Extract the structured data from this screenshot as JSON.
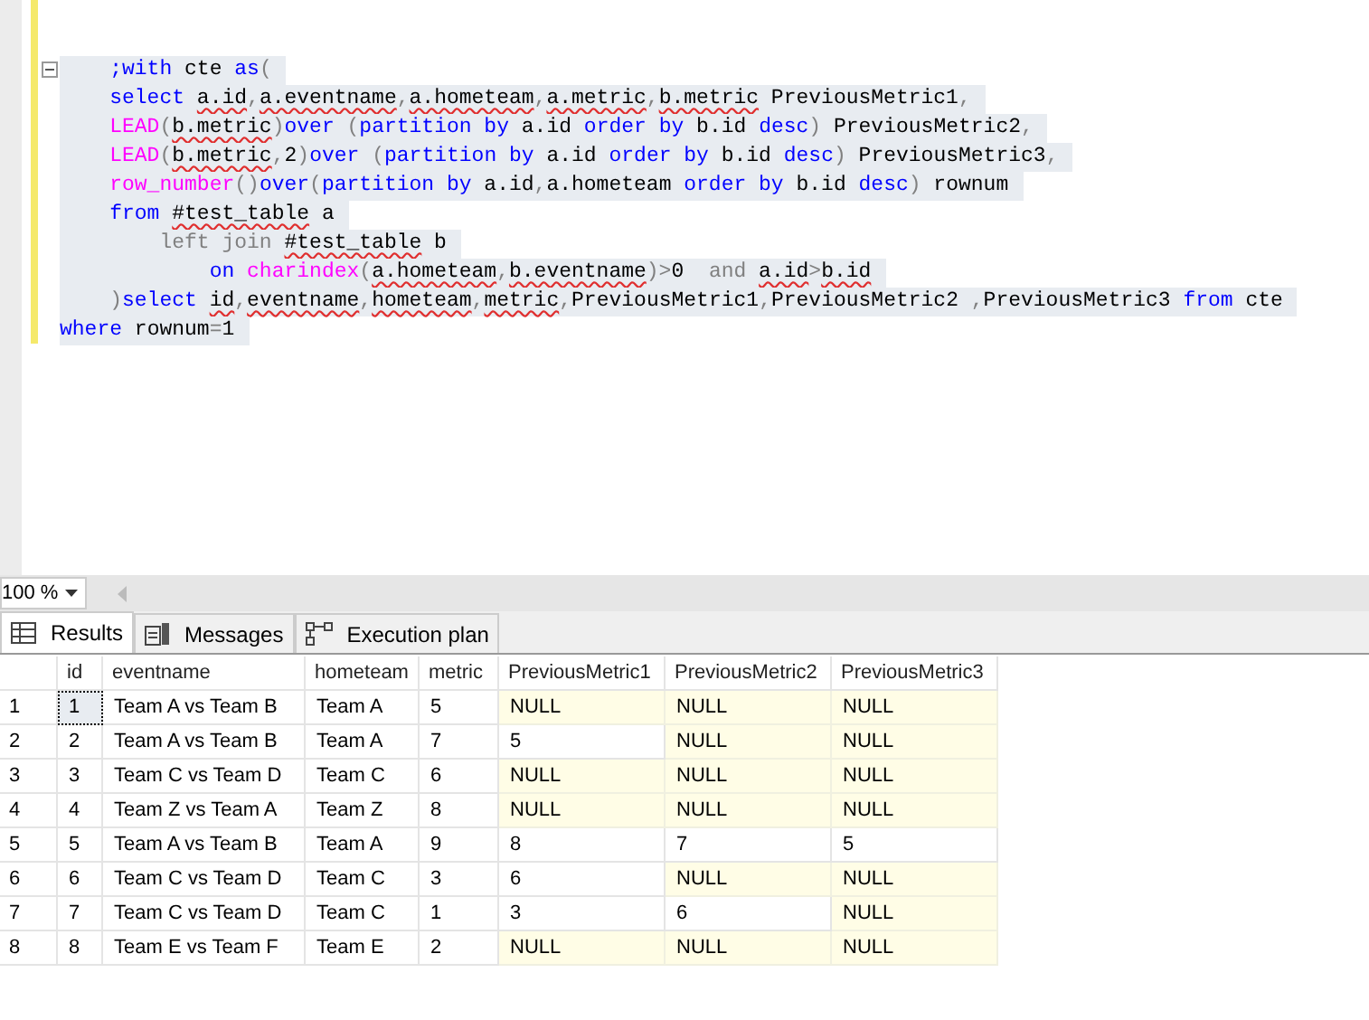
{
  "editor": {
    "fold_expanded": true,
    "lines": [
      [
        {
          "t": "    ;with ",
          "kind": "kw"
        },
        {
          "t": "cte ",
          "kind": "tx"
        },
        {
          "t": "as",
          "kind": "kw"
        },
        {
          "t": "(",
          "kind": "op"
        }
      ],
      [
        {
          "t": "    select ",
          "kind": "kw"
        },
        {
          "t": "a.id",
          "kind": "sq"
        },
        {
          "t": ",",
          "kind": "op"
        },
        {
          "t": "a.eventname",
          "kind": "sq"
        },
        {
          "t": ",",
          "kind": "op"
        },
        {
          "t": "a.hometeam",
          "kind": "sq"
        },
        {
          "t": ",",
          "kind": "op"
        },
        {
          "t": "a.metric",
          "kind": "sq"
        },
        {
          "t": ",",
          "kind": "op"
        },
        {
          "t": "b.metric",
          "kind": "sq"
        },
        {
          "t": " PreviousMetric1",
          "kind": "tx"
        },
        {
          "t": ",",
          "kind": "op"
        }
      ],
      [
        {
          "t": "    LEAD",
          "kind": "fn"
        },
        {
          "t": "(",
          "kind": "op"
        },
        {
          "t": "b.metric",
          "kind": "sq"
        },
        {
          "t": ")",
          "kind": "op"
        },
        {
          "t": "over ",
          "kind": "kw"
        },
        {
          "t": "(",
          "kind": "op"
        },
        {
          "t": "partition by",
          "kind": "kw"
        },
        {
          "t": " a.id ",
          "kind": "tx"
        },
        {
          "t": "order by",
          "kind": "kw"
        },
        {
          "t": " b.id ",
          "kind": "tx"
        },
        {
          "t": "desc",
          "kind": "kw"
        },
        {
          "t": ")",
          "kind": "op"
        },
        {
          "t": " PreviousMetric2",
          "kind": "tx"
        },
        {
          "t": ",",
          "kind": "op"
        }
      ],
      [
        {
          "t": "    LEAD",
          "kind": "fn"
        },
        {
          "t": "(",
          "kind": "op"
        },
        {
          "t": "b.metric",
          "kind": "sq"
        },
        {
          "t": ",",
          "kind": "op"
        },
        {
          "t": "2",
          "kind": "tx"
        },
        {
          "t": ")",
          "kind": "op"
        },
        {
          "t": "over ",
          "kind": "kw"
        },
        {
          "t": "(",
          "kind": "op"
        },
        {
          "t": "partition by",
          "kind": "kw"
        },
        {
          "t": " a.id ",
          "kind": "tx"
        },
        {
          "t": "order by",
          "kind": "kw"
        },
        {
          "t": " b.id ",
          "kind": "tx"
        },
        {
          "t": "desc",
          "kind": "kw"
        },
        {
          "t": ")",
          "kind": "op"
        },
        {
          "t": " PreviousMetric3",
          "kind": "tx"
        },
        {
          "t": ",",
          "kind": "op"
        }
      ],
      [
        {
          "t": "    row_number",
          "kind": "fn"
        },
        {
          "t": "()",
          "kind": "op"
        },
        {
          "t": "over",
          "kind": "kw"
        },
        {
          "t": "(",
          "kind": "op"
        },
        {
          "t": "partition by",
          "kind": "kw"
        },
        {
          "t": " a.id",
          "kind": "tx"
        },
        {
          "t": ",",
          "kind": "op"
        },
        {
          "t": "a.hometeam ",
          "kind": "tx"
        },
        {
          "t": "order by",
          "kind": "kw"
        },
        {
          "t": " b.id ",
          "kind": "tx"
        },
        {
          "t": "desc",
          "kind": "kw"
        },
        {
          "t": ")",
          "kind": "op"
        },
        {
          "t": " rownum",
          "kind": "tx"
        }
      ],
      [
        {
          "t": "    from ",
          "kind": "kw"
        },
        {
          "t": "#test_table",
          "kind": "sq"
        },
        {
          "t": " a",
          "kind": "tx"
        }
      ],
      [
        {
          "t": "        left join ",
          "kind": "op"
        },
        {
          "t": "#test_table",
          "kind": "sq"
        },
        {
          "t": " b",
          "kind": "tx"
        }
      ],
      [
        {
          "t": "            on ",
          "kind": "kw"
        },
        {
          "t": "charindex",
          "kind": "fn"
        },
        {
          "t": "(",
          "kind": "op"
        },
        {
          "t": "a.hometeam",
          "kind": "sq"
        },
        {
          "t": ",",
          "kind": "op"
        },
        {
          "t": "b.eventname",
          "kind": "sq"
        },
        {
          "t": ")>",
          "kind": "op"
        },
        {
          "t": "0  ",
          "kind": "tx"
        },
        {
          "t": "and ",
          "kind": "op"
        },
        {
          "t": "a.id",
          "kind": "sq"
        },
        {
          "t": ">",
          "kind": "op"
        },
        {
          "t": "b.id",
          "kind": "sq"
        }
      ],
      [
        {
          "t": "    )",
          "kind": "op"
        },
        {
          "t": "select ",
          "kind": "kw"
        },
        {
          "t": "id",
          "kind": "sq"
        },
        {
          "t": ",",
          "kind": "op"
        },
        {
          "t": "eventname",
          "kind": "sq"
        },
        {
          "t": ",",
          "kind": "op"
        },
        {
          "t": "hometeam",
          "kind": "sq"
        },
        {
          "t": ",",
          "kind": "op"
        },
        {
          "t": "metric",
          "kind": "sq"
        },
        {
          "t": ",",
          "kind": "op"
        },
        {
          "t": "PreviousMetric1",
          "kind": "tx"
        },
        {
          "t": ",",
          "kind": "op"
        },
        {
          "t": "PreviousMetric2 ",
          "kind": "tx"
        },
        {
          "t": ",",
          "kind": "op"
        },
        {
          "t": "PreviousMetric3 ",
          "kind": "tx"
        },
        {
          "t": "from",
          "kind": "kw"
        },
        {
          "t": " cte",
          "kind": "tx"
        }
      ],
      [
        {
          "t": "where",
          "kind": "kw"
        },
        {
          "t": " rownum",
          "kind": "tx"
        },
        {
          "t": "=",
          "kind": "op"
        },
        {
          "t": "1",
          "kind": "tx"
        }
      ]
    ]
  },
  "zoom": {
    "value": "100 %"
  },
  "tabs": [
    {
      "label": "Results",
      "selected": true
    },
    {
      "label": "Messages",
      "selected": false
    },
    {
      "label": "Execution plan",
      "selected": false
    }
  ],
  "grid": {
    "columns": [
      "id",
      "eventname",
      "hometeam",
      "metric",
      "PreviousMetric1",
      "PreviousMetric2",
      "PreviousMetric3"
    ],
    "rows": [
      {
        "header": "1",
        "cells": [
          {
            "text": "1",
            "null": false,
            "focused": true
          },
          {
            "text": "Team A vs Team B",
            "null": false,
            "focused": false
          },
          {
            "text": "Team A",
            "null": false,
            "focused": false
          },
          {
            "text": "5",
            "null": false,
            "focused": false
          },
          {
            "text": "NULL",
            "null": true,
            "focused": false
          },
          {
            "text": "NULL",
            "null": true,
            "focused": false
          },
          {
            "text": "NULL",
            "null": true,
            "focused": false
          }
        ]
      },
      {
        "header": "2",
        "cells": [
          {
            "text": "2",
            "null": false,
            "focused": false
          },
          {
            "text": "Team A vs Team B",
            "null": false,
            "focused": false
          },
          {
            "text": "Team A",
            "null": false,
            "focused": false
          },
          {
            "text": "7",
            "null": false,
            "focused": false
          },
          {
            "text": "5",
            "null": false,
            "focused": false
          },
          {
            "text": "NULL",
            "null": true,
            "focused": false
          },
          {
            "text": "NULL",
            "null": true,
            "focused": false
          }
        ]
      },
      {
        "header": "3",
        "cells": [
          {
            "text": "3",
            "null": false,
            "focused": false
          },
          {
            "text": "Team C vs Team D",
            "null": false,
            "focused": false
          },
          {
            "text": "Team C",
            "null": false,
            "focused": false
          },
          {
            "text": "6",
            "null": false,
            "focused": false
          },
          {
            "text": "NULL",
            "null": true,
            "focused": false
          },
          {
            "text": "NULL",
            "null": true,
            "focused": false
          },
          {
            "text": "NULL",
            "null": true,
            "focused": false
          }
        ]
      },
      {
        "header": "4",
        "cells": [
          {
            "text": "4",
            "null": false,
            "focused": false
          },
          {
            "text": "Team Z vs Team A",
            "null": false,
            "focused": false
          },
          {
            "text": "Team Z",
            "null": false,
            "focused": false
          },
          {
            "text": "8",
            "null": false,
            "focused": false
          },
          {
            "text": "NULL",
            "null": true,
            "focused": false
          },
          {
            "text": "NULL",
            "null": true,
            "focused": false
          },
          {
            "text": "NULL",
            "null": true,
            "focused": false
          }
        ]
      },
      {
        "header": "5",
        "cells": [
          {
            "text": "5",
            "null": false,
            "focused": false
          },
          {
            "text": "Team A vs Team B",
            "null": false,
            "focused": false
          },
          {
            "text": "Team A",
            "null": false,
            "focused": false
          },
          {
            "text": "9",
            "null": false,
            "focused": false
          },
          {
            "text": "8",
            "null": false,
            "focused": false
          },
          {
            "text": "7",
            "null": false,
            "focused": false
          },
          {
            "text": "5",
            "null": false,
            "focused": false
          }
        ]
      },
      {
        "header": "6",
        "cells": [
          {
            "text": "6",
            "null": false,
            "focused": false
          },
          {
            "text": "Team C vs Team D",
            "null": false,
            "focused": false
          },
          {
            "text": "Team C",
            "null": false,
            "focused": false
          },
          {
            "text": "3",
            "null": false,
            "focused": false
          },
          {
            "text": "6",
            "null": false,
            "focused": false
          },
          {
            "text": "NULL",
            "null": true,
            "focused": false
          },
          {
            "text": "NULL",
            "null": true,
            "focused": false
          }
        ]
      },
      {
        "header": "7",
        "cells": [
          {
            "text": "7",
            "null": false,
            "focused": false
          },
          {
            "text": "Team C vs Team D",
            "null": false,
            "focused": false
          },
          {
            "text": "Team C",
            "null": false,
            "focused": false
          },
          {
            "text": "1",
            "null": false,
            "focused": false
          },
          {
            "text": "3",
            "null": false,
            "focused": false
          },
          {
            "text": "6",
            "null": false,
            "focused": false
          },
          {
            "text": "NULL",
            "null": true,
            "focused": false
          }
        ]
      },
      {
        "header": "8",
        "cells": [
          {
            "text": "8",
            "null": false,
            "focused": false
          },
          {
            "text": "Team E vs Team F",
            "null": false,
            "focused": false
          },
          {
            "text": "Team E",
            "null": false,
            "focused": false
          },
          {
            "text": "2",
            "null": false,
            "focused": false
          },
          {
            "text": "NULL",
            "null": true,
            "focused": false
          },
          {
            "text": "NULL",
            "null": true,
            "focused": false
          },
          {
            "text": "NULL",
            "null": true,
            "focused": false
          }
        ]
      }
    ]
  }
}
